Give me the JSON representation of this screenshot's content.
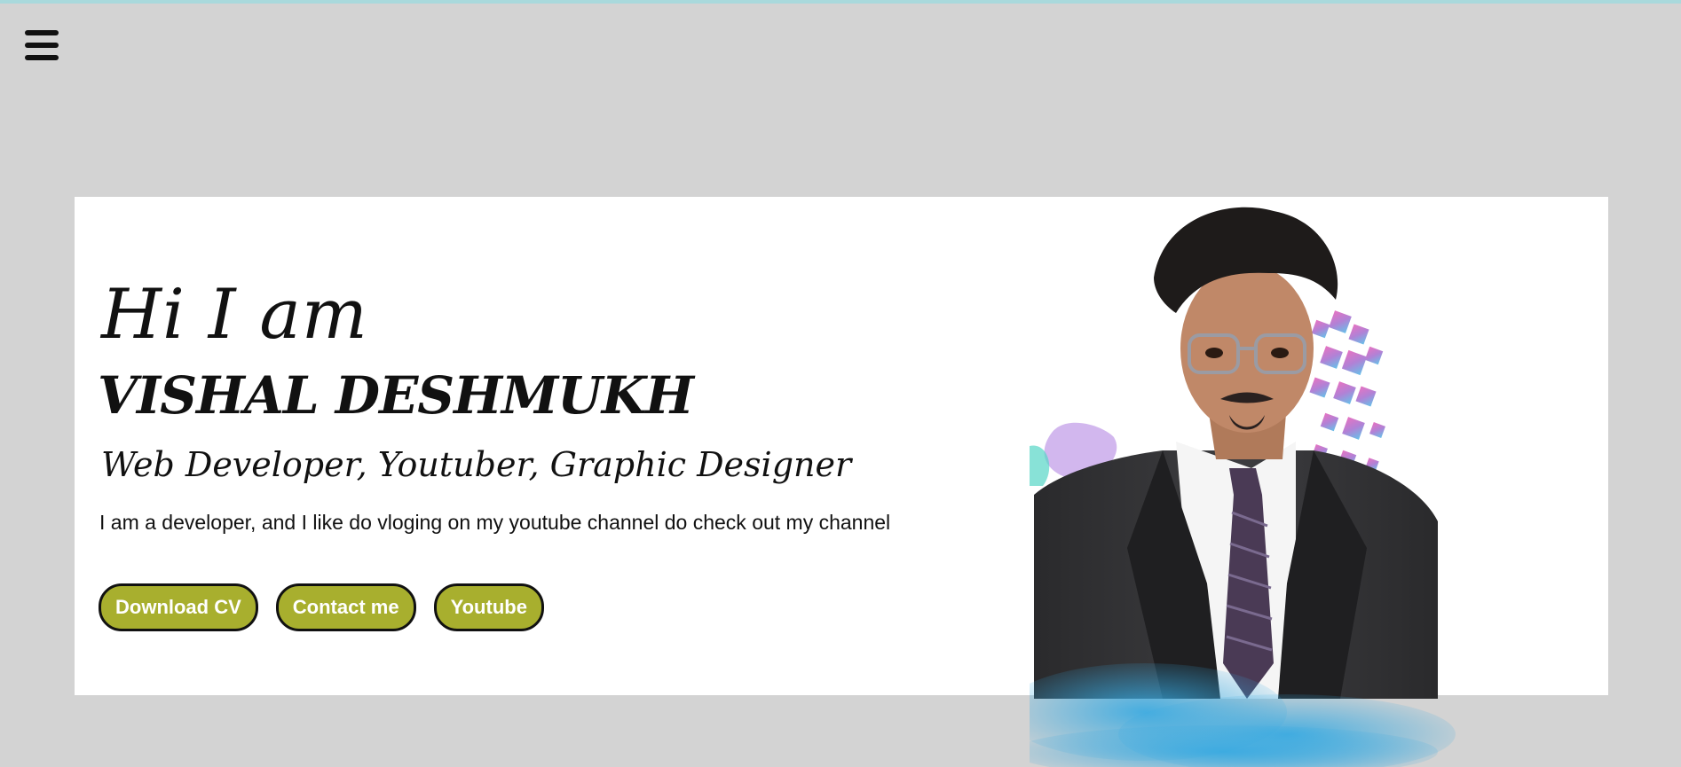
{
  "nav": {
    "menu_icon": "hamburger-menu-icon"
  },
  "hero": {
    "greeting": "Hi I am",
    "name": "VISHAL DESHMUKH",
    "roles": "Web Developer, Youtuber, Graphic Designer",
    "intro": "I am a developer, and I like do vloging on my youtube channel do check out my channel",
    "buttons": [
      {
        "label": "Download CV"
      },
      {
        "label": "Contact me"
      },
      {
        "label": "Youtube"
      }
    ]
  },
  "colors": {
    "background": "#d3d3d3",
    "card": "#ffffff",
    "button": "#a8af2e",
    "text": "#111111"
  }
}
